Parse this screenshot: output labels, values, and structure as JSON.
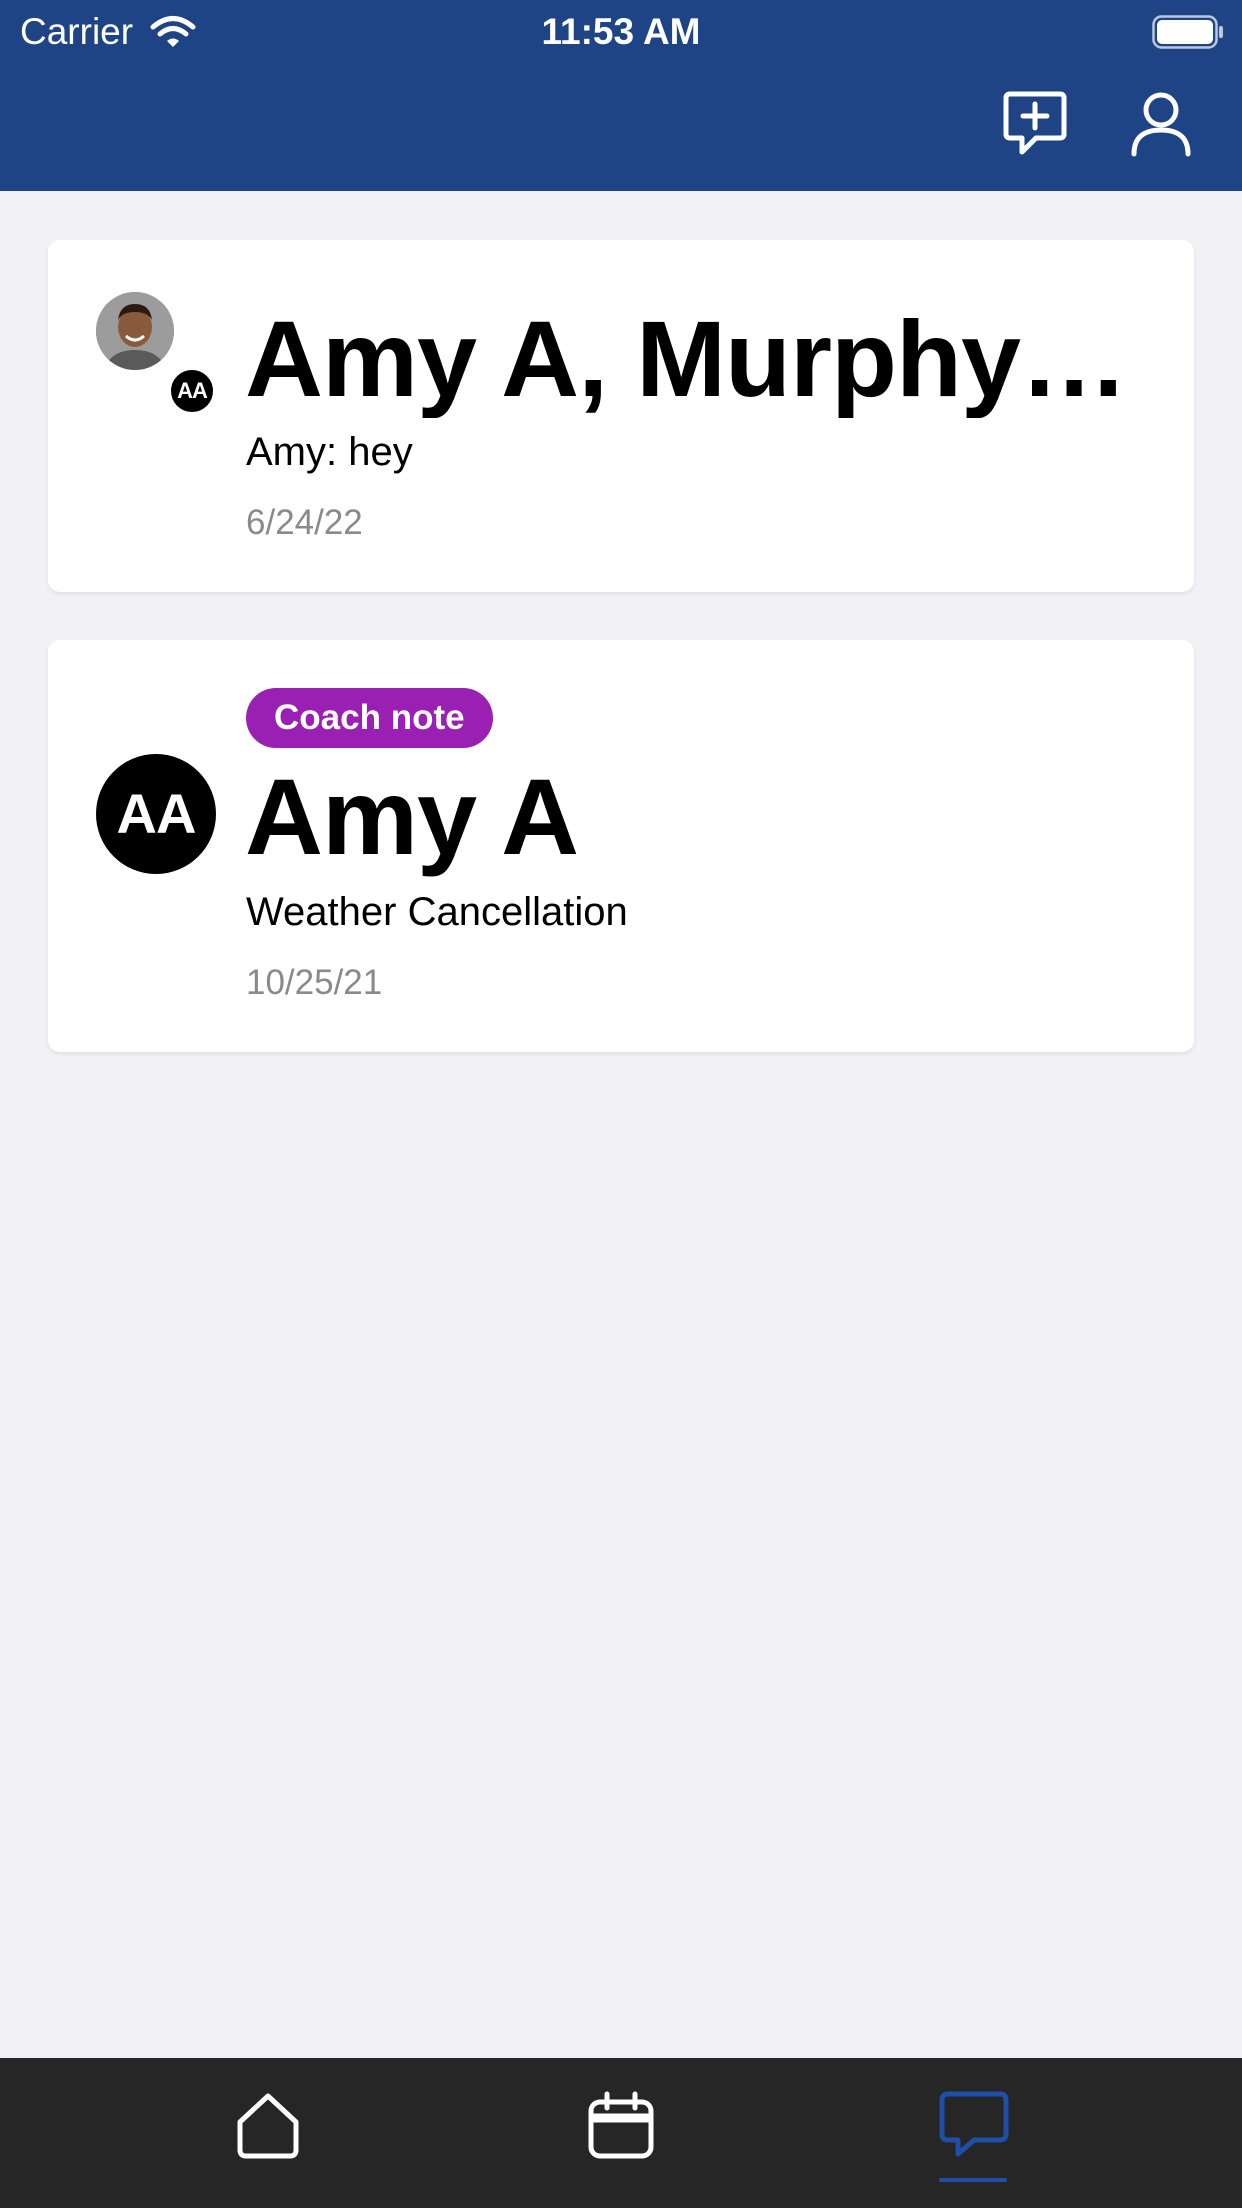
{
  "status_bar": {
    "carrier": "Carrier",
    "time": "11:53 AM",
    "icons": [
      "wifi-icon",
      "battery-icon"
    ]
  },
  "header": {
    "accent_color": "#1f4485",
    "actions": [
      "new-message-icon",
      "profile-icon"
    ]
  },
  "conversations": [
    {
      "title": "Amy A, Murphy…",
      "preview": "Amy: hey",
      "date": "6/24/22",
      "avatar_badge": "AA",
      "avatar_type": "photo"
    },
    {
      "badge": "Coach note",
      "badge_color": "#9a1fb3",
      "title": "Amy A",
      "preview": "Weather Cancellation",
      "date": "10/25/21",
      "avatar_initials": "AA"
    }
  ],
  "tab_bar": {
    "tabs": [
      "home-icon",
      "calendar-icon",
      "messages-icon"
    ],
    "active": "messages",
    "active_color": "#1f4fa8"
  }
}
